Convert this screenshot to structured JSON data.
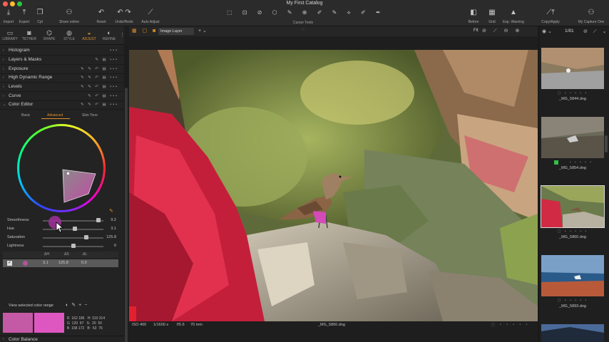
{
  "window": {
    "title": "My First Catalog"
  },
  "toolbar": {
    "left": [
      {
        "label": "Import",
        "icon": "import-icon"
      },
      {
        "label": "Export",
        "icon": "export-icon"
      },
      {
        "label": "Cpl",
        "icon": "copy-icon"
      },
      {
        "label": "Share online",
        "icon": "share-icon"
      },
      {
        "label": "Reset",
        "icon": "reset-icon"
      },
      {
        "label": "Undo/Redo",
        "icon": "undo-redo-icon"
      },
      {
        "label": "Auto Adjust",
        "icon": "auto-adjust-icon"
      }
    ],
    "cursor_tools_label": "Cursor Tools",
    "right": [
      {
        "label": "Before",
        "icon": "before-icon"
      },
      {
        "label": "Grid",
        "icon": "grid-icon"
      },
      {
        "label": "Exp. Warning",
        "icon": "warning-icon"
      },
      {
        "label": "Copy/Apply",
        "icon": "copy-apply-icon"
      },
      {
        "label": "My Capture One",
        "icon": "user-icon"
      }
    ]
  },
  "tool_tabs": [
    {
      "label": "LIBRARY"
    },
    {
      "label": "TETHER"
    },
    {
      "label": "SHAPE"
    },
    {
      "label": "STYLE"
    },
    {
      "label": "ADJUST",
      "active": true
    },
    {
      "label": "REFINE"
    }
  ],
  "sections": [
    {
      "name": "Histogram",
      "expanded": false
    },
    {
      "name": "Layers & Masks",
      "expanded": false
    },
    {
      "name": "Exposure",
      "expanded": false
    },
    {
      "name": "High Dynamic Range",
      "expanded": false
    },
    {
      "name": "Levels",
      "expanded": false
    },
    {
      "name": "Curve",
      "expanded": false
    },
    {
      "name": "Color Editor",
      "expanded": true
    }
  ],
  "color_editor": {
    "tabs": [
      "Basic",
      "Advanced",
      "Skin Tone"
    ],
    "active_tab": "Advanced",
    "sliders": [
      {
        "label": "Smoothness",
        "value": "9.2",
        "level": 0.92
      },
      {
        "label": "Hue",
        "value": "3.1",
        "level": 0.53
      },
      {
        "label": "Saturation",
        "value": "125.8",
        "level": 0.72
      },
      {
        "label": "Lightness",
        "value": "0",
        "level": 0.5
      }
    ],
    "table_headers": [
      "ΔH",
      "ΔS",
      "ΔL"
    ],
    "table_row": {
      "checked": true,
      "dh": "3.1",
      "ds": "125.8",
      "dl": "0.0"
    },
    "view_range_label": "View selected color range",
    "readout": "R  162 186   H: 310 314\nG  129  97   S:  20  50\nB  158 172   B:  63  76",
    "swatch_before": "#c45aa6",
    "swatch_after": "#de57c0"
  },
  "next_section": "Color Balance",
  "viewer": {
    "layer_select": "Image Layer",
    "zoom": "Fit",
    "status": {
      "iso": "ISO 400",
      "shutter": "1/1600 s",
      "aperture": "f/5.6",
      "focal": "70 mm",
      "filename": "_MG_5860.dng"
    }
  },
  "browser": {
    "count": "1/81",
    "thumbnails": [
      {
        "filename": "_MG_5844.dng",
        "selected": false,
        "tag": ""
      },
      {
        "filename": "_MG_5854.dng",
        "selected": false,
        "tag": "green"
      },
      {
        "filename": "_MG_5860.dng",
        "selected": true,
        "tag": ""
      },
      {
        "filename": "_MG_5893.dng",
        "selected": false,
        "tag": ""
      }
    ]
  },
  "colors": {
    "accent": "#e0902a",
    "panel": "#232323"
  }
}
